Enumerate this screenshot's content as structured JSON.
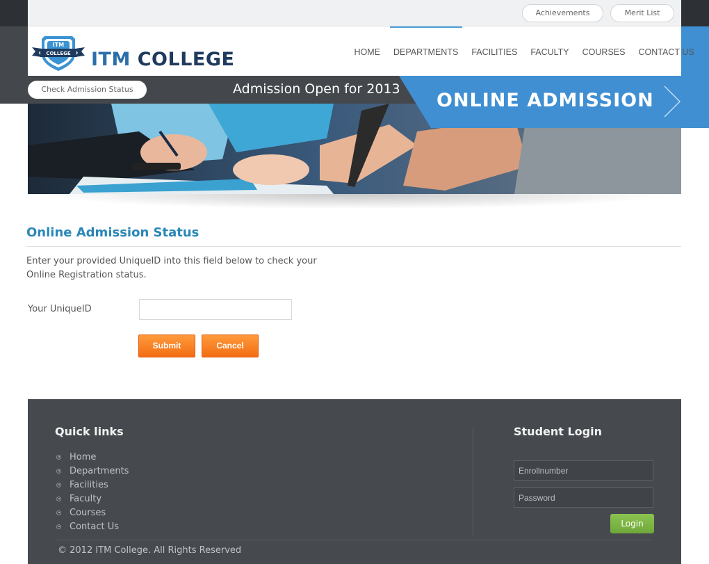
{
  "top_links": {
    "achievements": "Achievements",
    "merit_list": "Merit List"
  },
  "logo": {
    "badge_top": "ITM",
    "badge_ribbon": "COLLEGE",
    "name_first": "ITM ",
    "name_second": "COLLEGE"
  },
  "nav": {
    "items": [
      "HOME",
      "DEPARTMENTS",
      "FACILITIES",
      "FACULTY",
      "COURSES",
      "CONTACT US"
    ],
    "active": "DEPARTMENTS"
  },
  "admission_bar": {
    "check_status": "Check Admission Status",
    "announcement": "Admission Open for 2013",
    "online_admission": "ONLINE ADMISSION"
  },
  "content": {
    "title": "Online Admission Status",
    "intro_line1": "Enter your provided UniqueID into this field below to check your",
    "intro_line2": "Online Registration status.",
    "field_label": "Your UniqueID",
    "field_value": "",
    "submit": "Submit",
    "cancel": "Cancel"
  },
  "footer": {
    "quick_links_heading": "Quick links",
    "quick_links": [
      "Home",
      "Departments",
      "Facilities",
      "Faculty",
      "Courses",
      "Contact Us"
    ],
    "student_login_heading": "Student Login",
    "enroll_placeholder": "Enrollnumber",
    "password_placeholder": "Password",
    "login": "Login",
    "copyright": "© 2012 ITM College. All Rights Reserved"
  },
  "colors": {
    "accent_blue": "#3f8fd2",
    "title_blue": "#2a87b8",
    "button_orange": "#f36d12",
    "login_green": "#7ab544",
    "footer_bg": "#464a4e"
  }
}
